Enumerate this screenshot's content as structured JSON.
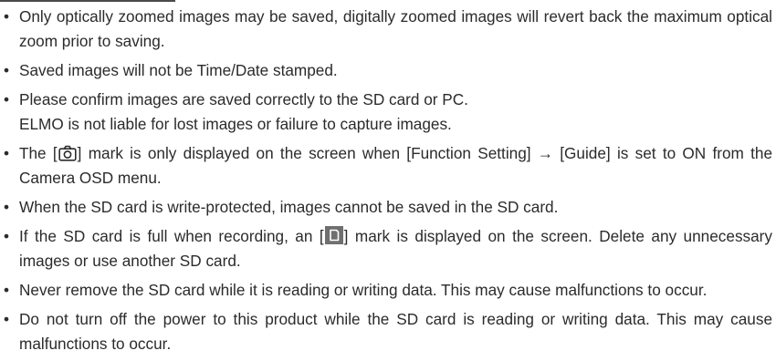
{
  "notes": [
    {
      "text": "Only optically zoomed images may be saved, digitally zoomed images will revert back the maximum optical zoom prior to saving."
    },
    {
      "text": "Saved images will not be Time/Date stamped."
    },
    {
      "text": "Please confirm images are saved correctly to the SD card or PC."
    },
    {
      "text": "ELMO is not liable for lost images or failure to capture images."
    },
    {
      "before": "The [",
      "icon": "camera-icon",
      "after": "] mark is only displayed on the screen when [Function Setting] → [Guide] is set to ON from the Camera OSD menu."
    },
    {
      "text": "When the SD card is write-protected, images cannot be saved in the SD card."
    },
    {
      "before": "If the SD card is full when recording, an [",
      "icon": "sd-card-full-icon",
      "after": "] mark is displayed on the screen. Delete any unnecessary images or use another SD card."
    },
    {
      "text": "Never remove the SD card while it is reading or writing data. This may cause malfunctions to occur."
    },
    {
      "text": "Do not turn off the power to this product while the SD card is reading or writing data. This may cause malfunctions to occur."
    }
  ],
  "bullet": "•",
  "colors": {
    "text": "#2b2b2b",
    "icon_box": "#6f6f6f"
  }
}
